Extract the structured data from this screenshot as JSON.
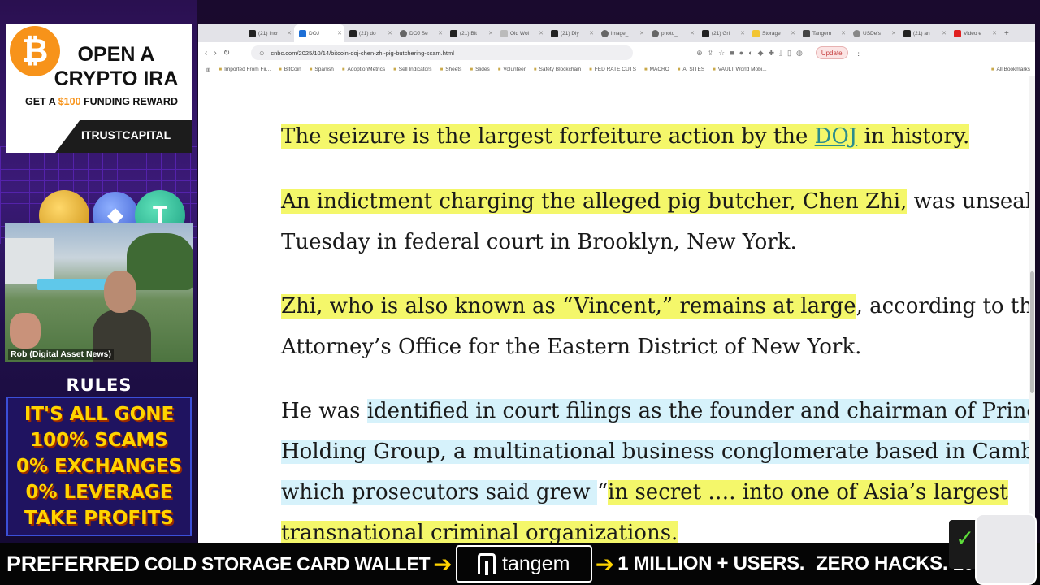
{
  "sidebar": {
    "ad": {
      "badge_symbol": "₿",
      "title": "OPEN A CRYPTO IRA",
      "sub_prefix": "GET A ",
      "sub_amount": "$100",
      "sub_suffix": " FUNDING REWARD",
      "brand": "ITRUSTCAPITAL",
      "accent_color": "#f7931a"
    },
    "coins": {
      "eth_symbol": "◆",
      "usdt_symbol": "T"
    },
    "webcam_name": "Rob (Digital Asset News)",
    "rules": {
      "title": "RULES",
      "items": [
        "IT'S ALL GONE",
        "100% SCAMS",
        "0% EXCHANGES",
        "0% LEVERAGE",
        "TAKE PROFITS"
      ],
      "text_color": "#ffd400"
    }
  },
  "browser": {
    "tabs": [
      {
        "label": "(21) Incr"
      },
      {
        "label": "DOJ",
        "active": true
      },
      {
        "label": "(21) do"
      },
      {
        "label": "DOJ Se"
      },
      {
        "label": "(21) Bit"
      },
      {
        "label": "Old Wol"
      },
      {
        "label": "(21) Diy"
      },
      {
        "label": "image_"
      },
      {
        "label": "photo_"
      },
      {
        "label": "(21) Gri"
      },
      {
        "label": "Storage"
      },
      {
        "label": "Tangem"
      },
      {
        "label": "USDe's"
      },
      {
        "label": "(21) an"
      },
      {
        "label": "Video e"
      }
    ],
    "new_tab": "+",
    "url": "cnbc.com/2025/10/14/bitcoin-doj-chen-zhi-pig-butchering-scam.html",
    "update_label": "Update",
    "bookmarks": [
      "Imported From Fir...",
      "BitCoin",
      "Spanish",
      "AdoptionMetrics",
      "Sell Indicators",
      "Sheets",
      "Slides",
      "Volunteer",
      "Safety Blockchain",
      "FED RATE CUTS",
      "MACRO",
      "AI SITES",
      "VAULT World Mobi..."
    ],
    "all_bookmarks": "All Bookmarks"
  },
  "article": {
    "p1": {
      "pre": "The seizure is the largest forfeiture action by the ",
      "link": "DOJ",
      "post": " in history."
    },
    "p2": {
      "line1_hl": "An indictment charging the alleged pig butcher, Chen Zhi,",
      "line1_rest": " was unsealed",
      "line2": "Tuesday in federal court in Brooklyn, New York."
    },
    "p3": {
      "line1_hl": "Zhi, who is also known as “Vincent,” remains at large",
      "line1_rest": ", according to the U",
      "line2": "Attorney’s Office for the Eastern District of New York."
    },
    "p4": {
      "line1_pre": "He was ",
      "line1_hl": "identified in court filings as the founder and chairman of Prince",
      "line2_hl": "Holding Group, a multinational business conglomerate based in Cambo",
      "line3_hl": "which prosecutors said grew ",
      "line3_q": "“",
      "line3_y": "in secret …. into one of Asia’s largest",
      "line4_y": "transnational criminal organizations."
    }
  },
  "banner": {
    "text1": "PREFERRED",
    "text2": "COLD STORAGE CARD WALLET",
    "arrow": "➔",
    "brand": "tangem",
    "text3": "1 MILLION + USERS.",
    "text4": "ZERO HACKS. 10% OFF"
  }
}
